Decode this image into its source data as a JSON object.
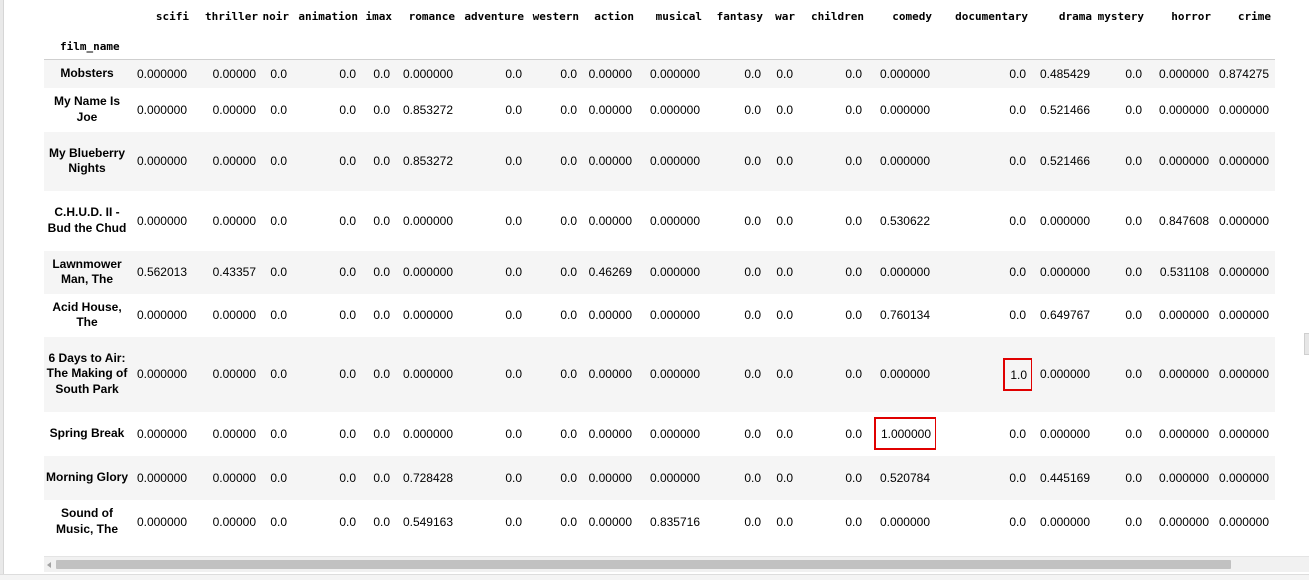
{
  "table": {
    "index_name": "film_name",
    "columns": [
      "scifi",
      "thriller",
      "noir",
      "animation",
      "imax",
      "romance",
      "adventure",
      "western",
      "action",
      "musical",
      "fantasy",
      "war",
      "children",
      "comedy",
      "documentary",
      "drama",
      "mystery",
      "horror",
      "crime"
    ],
    "rows": [
      {
        "name": "Mobsters",
        "values": [
          "0.000000",
          "0.00000",
          "0.0",
          "0.0",
          "0.0",
          "0.000000",
          "0.0",
          "0.0",
          "0.00000",
          "0.000000",
          "0.0",
          "0.0",
          "0.0",
          "0.000000",
          "0.0",
          "0.485429",
          "0.0",
          "0.000000",
          "0.874275"
        ]
      },
      {
        "name": "My Name Is Joe",
        "values": [
          "0.000000",
          "0.00000",
          "0.0",
          "0.0",
          "0.0",
          "0.853272",
          "0.0",
          "0.0",
          "0.00000",
          "0.000000",
          "0.0",
          "0.0",
          "0.0",
          "0.000000",
          "0.0",
          "0.521466",
          "0.0",
          "0.000000",
          "0.000000"
        ]
      },
      {
        "name": "My Blueberry Nights",
        "values": [
          "0.000000",
          "0.00000",
          "0.0",
          "0.0",
          "0.0",
          "0.853272",
          "0.0",
          "0.0",
          "0.00000",
          "0.000000",
          "0.0",
          "0.0",
          "0.0",
          "0.000000",
          "0.0",
          "0.521466",
          "0.0",
          "0.000000",
          "0.000000"
        ]
      },
      {
        "name": "C.H.U.D. II - Bud the Chud",
        "values": [
          "0.000000",
          "0.00000",
          "0.0",
          "0.0",
          "0.0",
          "0.000000",
          "0.0",
          "0.0",
          "0.00000",
          "0.000000",
          "0.0",
          "0.0",
          "0.0",
          "0.530622",
          "0.0",
          "0.000000",
          "0.0",
          "0.847608",
          "0.000000"
        ]
      },
      {
        "name": "Lawnmower Man, The",
        "values": [
          "0.562013",
          "0.43357",
          "0.0",
          "0.0",
          "0.0",
          "0.000000",
          "0.0",
          "0.0",
          "0.46269",
          "0.000000",
          "0.0",
          "0.0",
          "0.0",
          "0.000000",
          "0.0",
          "0.000000",
          "0.0",
          "0.531108",
          "0.000000"
        ]
      },
      {
        "name": "Acid House, The",
        "values": [
          "0.000000",
          "0.00000",
          "0.0",
          "0.0",
          "0.0",
          "0.000000",
          "0.0",
          "0.0",
          "0.00000",
          "0.000000",
          "0.0",
          "0.0",
          "0.0",
          "0.760134",
          "0.0",
          "0.649767",
          "0.0",
          "0.000000",
          "0.000000"
        ]
      },
      {
        "name": "6 Days to Air: The Making of South Park",
        "values": [
          "0.000000",
          "0.00000",
          "0.0",
          "0.0",
          "0.0",
          "0.000000",
          "0.0",
          "0.0",
          "0.00000",
          "0.000000",
          "0.0",
          "0.0",
          "0.0",
          "0.000000",
          "1.0",
          "0.000000",
          "0.0",
          "0.000000",
          "0.000000"
        ]
      },
      {
        "name": "Spring Break",
        "values": [
          "0.000000",
          "0.00000",
          "0.0",
          "0.0",
          "0.0",
          "0.000000",
          "0.0",
          "0.0",
          "0.00000",
          "0.000000",
          "0.0",
          "0.0",
          "0.0",
          "1.000000",
          "0.0",
          "0.000000",
          "0.0",
          "0.000000",
          "0.000000"
        ]
      },
      {
        "name": "Morning Glory",
        "values": [
          "0.000000",
          "0.00000",
          "0.0",
          "0.0",
          "0.0",
          "0.728428",
          "0.0",
          "0.0",
          "0.00000",
          "0.000000",
          "0.0",
          "0.0",
          "0.0",
          "0.520784",
          "0.0",
          "0.445169",
          "0.0",
          "0.000000",
          "0.000000"
        ]
      },
      {
        "name": "Sound of Music, The",
        "values": [
          "0.000000",
          "0.00000",
          "0.0",
          "0.0",
          "0.0",
          "0.549163",
          "0.0",
          "0.0",
          "0.00000",
          "0.835716",
          "0.0",
          "0.0",
          "0.0",
          "0.000000",
          "0.0",
          "0.000000",
          "0.0",
          "0.000000",
          "0.000000"
        ]
      }
    ],
    "highlighted_cells": [
      {
        "row": 6,
        "col": 14
      },
      {
        "row": 7,
        "col": 13
      }
    ]
  },
  "colors": {
    "highlight_border": "#e00000",
    "stripe": "#f5f5f5"
  }
}
